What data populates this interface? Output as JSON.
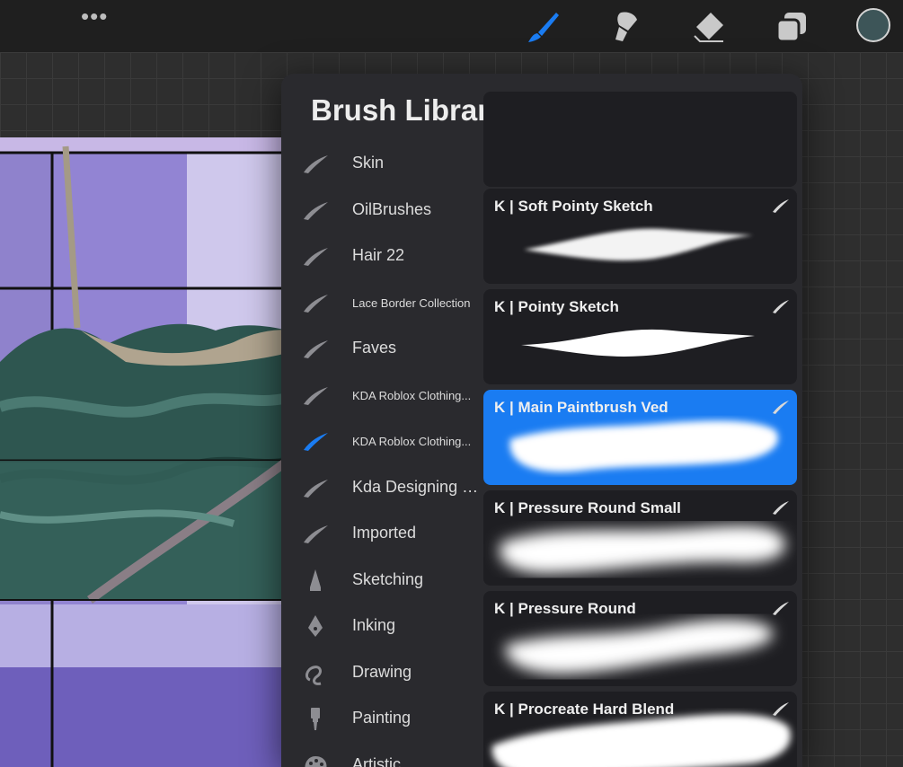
{
  "toolbar": {
    "more_icon": "•••",
    "tools": [
      "brush-icon",
      "smudge-icon",
      "eraser-icon",
      "layers-icon"
    ],
    "active_tool": "brush-icon",
    "active_color": "#3d5558",
    "accent": "#1a7cf2"
  },
  "panel": {
    "title": "Brush Library",
    "add_icon": "plus-icon"
  },
  "groups": [
    {
      "label": "Skin",
      "small": false,
      "icon": "brush-stroke-icon"
    },
    {
      "label": "OilBrushes",
      "small": false,
      "icon": "brush-stroke-icon"
    },
    {
      "label": "Hair 22",
      "small": false,
      "icon": "brush-stroke-icon"
    },
    {
      "label": "Lace Border Collection",
      "small": true,
      "icon": "brush-stroke-icon"
    },
    {
      "label": "Faves",
      "small": false,
      "icon": "brush-stroke-icon"
    },
    {
      "label": "KDA Roblox Clothing...",
      "small": true,
      "icon": "brush-stroke-icon"
    },
    {
      "label": "KDA Roblox Clothing...",
      "small": true,
      "icon": "brush-stroke-icon",
      "selected": true
    },
    {
      "label": "Kda Designing Set",
      "small": false,
      "icon": "brush-stroke-icon"
    },
    {
      "label": "Imported",
      "small": false,
      "icon": "brush-stroke-icon"
    },
    {
      "label": "Sketching",
      "small": false,
      "icon": "pencil-icon"
    },
    {
      "label": "Inking",
      "small": false,
      "icon": "pen-nib-icon"
    },
    {
      "label": "Drawing",
      "small": false,
      "icon": "squiggle-icon"
    },
    {
      "label": "Painting",
      "small": false,
      "icon": "paintbrush-icon"
    },
    {
      "label": "Artistic",
      "small": false,
      "icon": "palette-icon"
    }
  ],
  "brushes": [
    {
      "name": "",
      "style": "partial"
    },
    {
      "name": "K | Soft Pointy Sketch",
      "style": "soft-pointy"
    },
    {
      "name": "K | Pointy Sketch",
      "style": "pointy"
    },
    {
      "name": "K | Main Paintbrush Ved",
      "style": "main",
      "selected": true
    },
    {
      "name": "K | Pressure Round Small",
      "style": "pressure-small"
    },
    {
      "name": "K | Pressure Round",
      "style": "pressure"
    },
    {
      "name": "K | Procreate Hard Blend",
      "style": "hard-blend"
    }
  ]
}
